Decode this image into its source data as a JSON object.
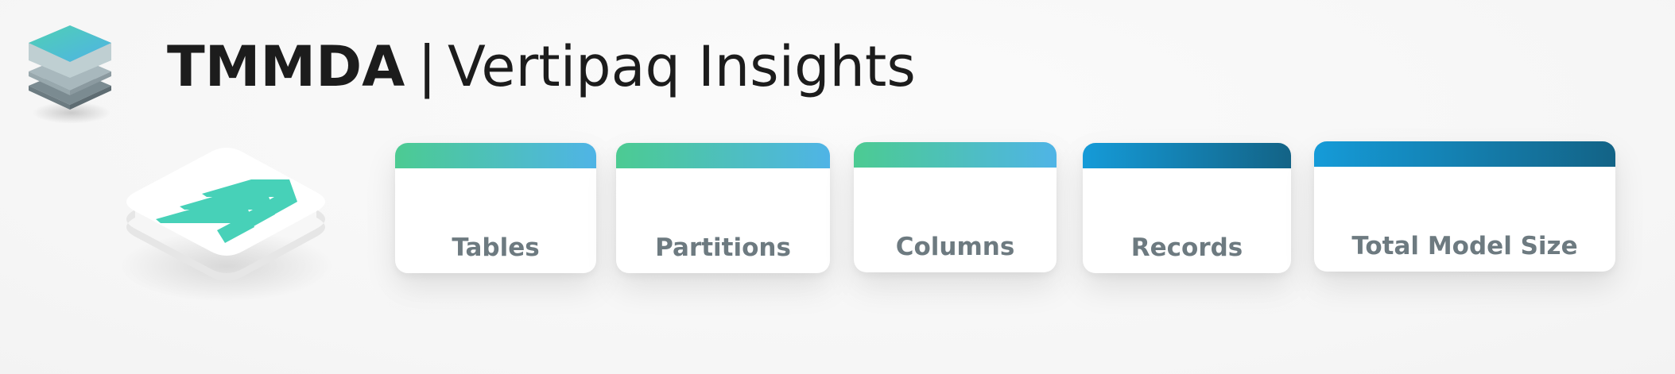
{
  "header": {
    "brand": "TMMDA",
    "separator": "|",
    "subtitle": "Vertipaq Insights"
  },
  "icons": {
    "logo": "layered-stack-icon",
    "tile": "triple-chevron-icon"
  },
  "colors": {
    "green_gradient": [
      "#4ccb92",
      "#4fb4e6"
    ],
    "blue_gradient": [
      "#159bd8",
      "#136386"
    ],
    "chevron": "#47d1b8",
    "title": "#1c1c1c",
    "label": "#6d7a80"
  },
  "cards": [
    {
      "label": "Tables",
      "accent": "green"
    },
    {
      "label": "Partitions",
      "accent": "green"
    },
    {
      "label": "Columns",
      "accent": "green"
    },
    {
      "label": "Records",
      "accent": "blue"
    },
    {
      "label": "Total Model Size",
      "accent": "blue"
    }
  ]
}
